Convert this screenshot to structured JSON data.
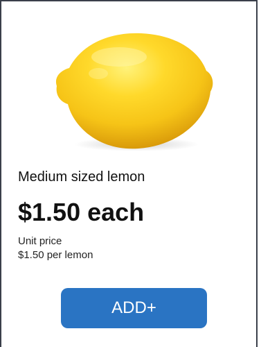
{
  "product": {
    "name": "Medium sized lemon",
    "price": "$1.50 each",
    "unit_price_label": "Unit price",
    "unit_price_value": "$1.50 per lemon",
    "image_icon": "lemon-image"
  },
  "actions": {
    "add_label": "ADD+"
  },
  "colors": {
    "border": "#3a3f4a",
    "button": "#2a74c3",
    "button_text": "#ffffff",
    "lemon": "#f6c417"
  }
}
